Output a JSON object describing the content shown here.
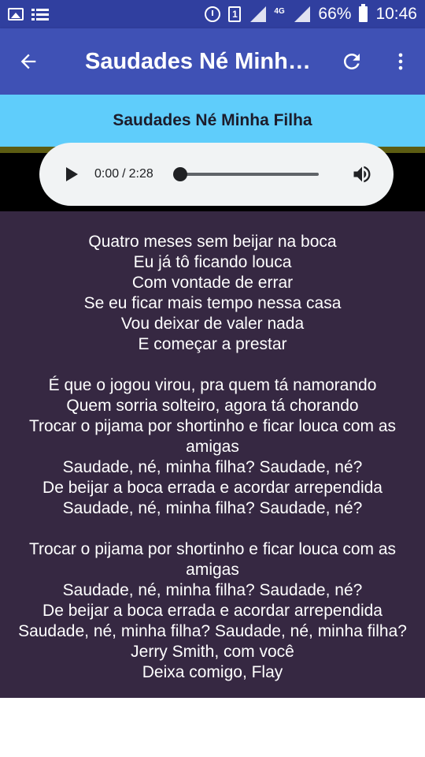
{
  "status_bar": {
    "battery": "66%",
    "time": "10:46",
    "network": "4G",
    "sim": "1",
    "icons": [
      "image-icon",
      "list-icon",
      "alarm-icon",
      "sim-icon",
      "signal-icon",
      "battery-icon"
    ]
  },
  "app_bar": {
    "title": "Saudades Né Minha...",
    "icons": [
      "arrow-back-icon",
      "refresh-icon",
      "more-vert-icon"
    ]
  },
  "song": {
    "title": "Saudades Né Minha Filha"
  },
  "player": {
    "current_time": "0:00",
    "separator": "/",
    "duration": "2:28",
    "progress": 0
  },
  "lyrics": {
    "stanza1": [
      "Quatro meses sem beijar na boca",
      "Eu já tô ficando louca",
      "Com vontade de errar",
      "Se eu ficar mais tempo nessa casa",
      "Vou deixar de valer nada",
      "E começar a prestar"
    ],
    "stanza2": [
      "É que o jogou virou, pra quem tá namorando",
      "Quem sorria solteiro, agora tá chorando",
      "Trocar o pijama por shortinho e ficar louca com as amigas",
      "Saudade, né, minha filha? Saudade, né?",
      "De beijar a boca errada e acordar arrependida",
      "Saudade, né, minha filha? Saudade, né?"
    ],
    "stanza3": [
      "Trocar o pijama por shortinho e ficar louca com as amigas",
      "Saudade, né, minha filha? Saudade, né?",
      "De beijar a boca errada e acordar arrependida",
      "Saudade, né, minha filha? Saudade, né, minha filha?",
      "Jerry Smith, com você",
      "Deixa comigo, Flay"
    ]
  },
  "colors": {
    "status_bar": "#303f9f",
    "app_bar": "#3f51b5",
    "song_header": "#5fcdfb",
    "lyrics_bg": "#362842",
    "player_bg": "#f1f3f4"
  }
}
